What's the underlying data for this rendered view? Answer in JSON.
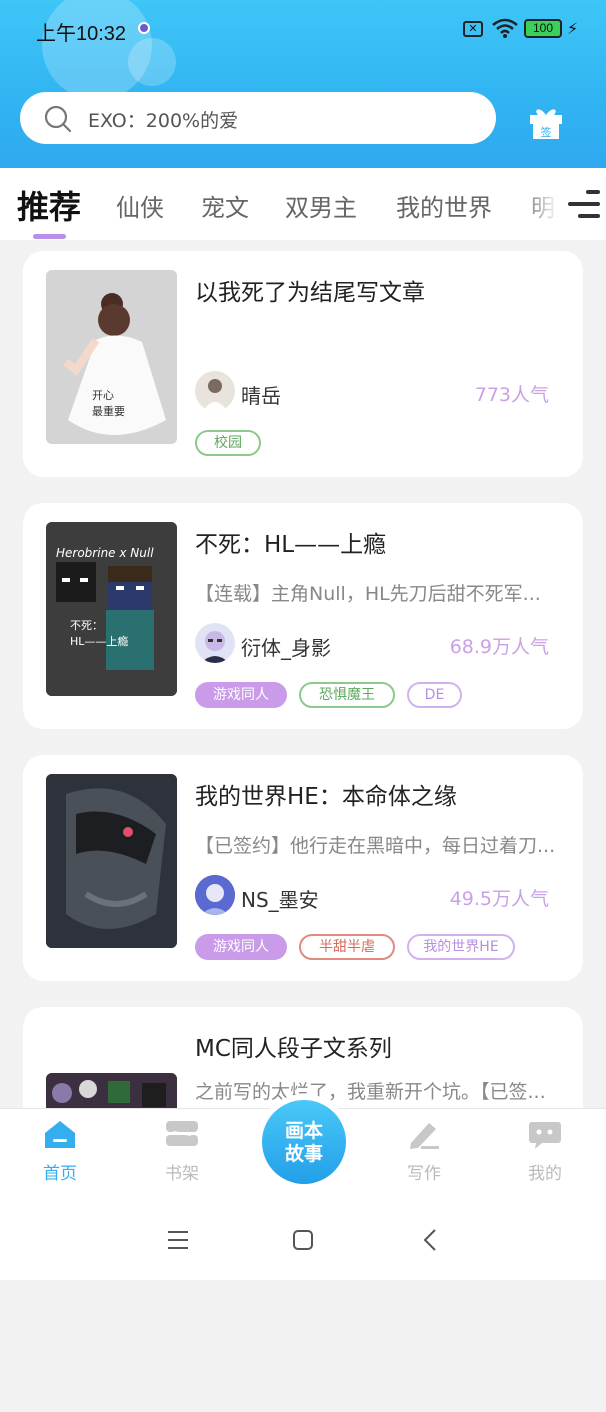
{
  "status_bar": {
    "time": "上午10:32",
    "sim_icon": "x-sim-icon",
    "wifi_icon": "wifi-icon",
    "battery": "100",
    "colors": {
      "battery": "#3ad15a"
    }
  },
  "search": {
    "placeholder": "EXO：200%的爱",
    "icon": "search-icon"
  },
  "gift": {
    "label": "签",
    "icon": "gift-sign-in-icon"
  },
  "tabs": [
    {
      "label": "推荐",
      "active": true
    },
    {
      "label": "仙侠"
    },
    {
      "label": "宠文"
    },
    {
      "label": "双男主"
    },
    {
      "label": "我的世界"
    },
    {
      "label": "明星"
    }
  ],
  "stories": [
    {
      "title": "以我死了为结尾写文章",
      "description": "",
      "author": "晴岳",
      "popularity": "773人气",
      "cover_text": "开心\n最重要",
      "tags": [
        {
          "label": "校园",
          "style": "green"
        }
      ]
    },
    {
      "title": "不死：HL——上瘾",
      "description": "【连载】主角Null，HL先刀后甜不死军...",
      "author": "衍体_身影",
      "popularity": "68.9万人气",
      "cover_text": "Herobrine x Null",
      "cover_subtext": "不死：\nHL——上瘾",
      "tags": [
        {
          "label": "游戏同人",
          "style": "fill"
        },
        {
          "label": "恐惧魔王",
          "style": "green"
        },
        {
          "label": "DE",
          "style": "purple"
        }
      ]
    },
    {
      "title": "我的世界HE：本命体之缘",
      "description": "【已签约】他行走在黑暗中，每日过着刀...",
      "author": "NS_墨安",
      "popularity": "49.5万人气",
      "tags": [
        {
          "label": "游戏同人",
          "style": "fill"
        },
        {
          "label": "半甜半虐",
          "style": "red"
        },
        {
          "label": "我的世界HE",
          "style": "purple"
        }
      ]
    },
    {
      "title": "MC同人段子文系列",
      "description": "之前写的太烂了，我重新开个坑。【已签..."
    }
  ],
  "bottom_nav": [
    {
      "label": "首页",
      "icon": "home-icon",
      "active": true
    },
    {
      "label": "书架",
      "icon": "bookshelf-icon"
    },
    {
      "label": "写作",
      "icon": "pen-icon"
    },
    {
      "label": "我的",
      "icon": "profile-chat-icon"
    }
  ],
  "center_button": {
    "line1": "画本",
    "line2": "故事"
  },
  "accent_colors": {
    "primary": "#35aef0",
    "tag_purple": "#c99be8",
    "popularity": "#c9a2e6"
  }
}
